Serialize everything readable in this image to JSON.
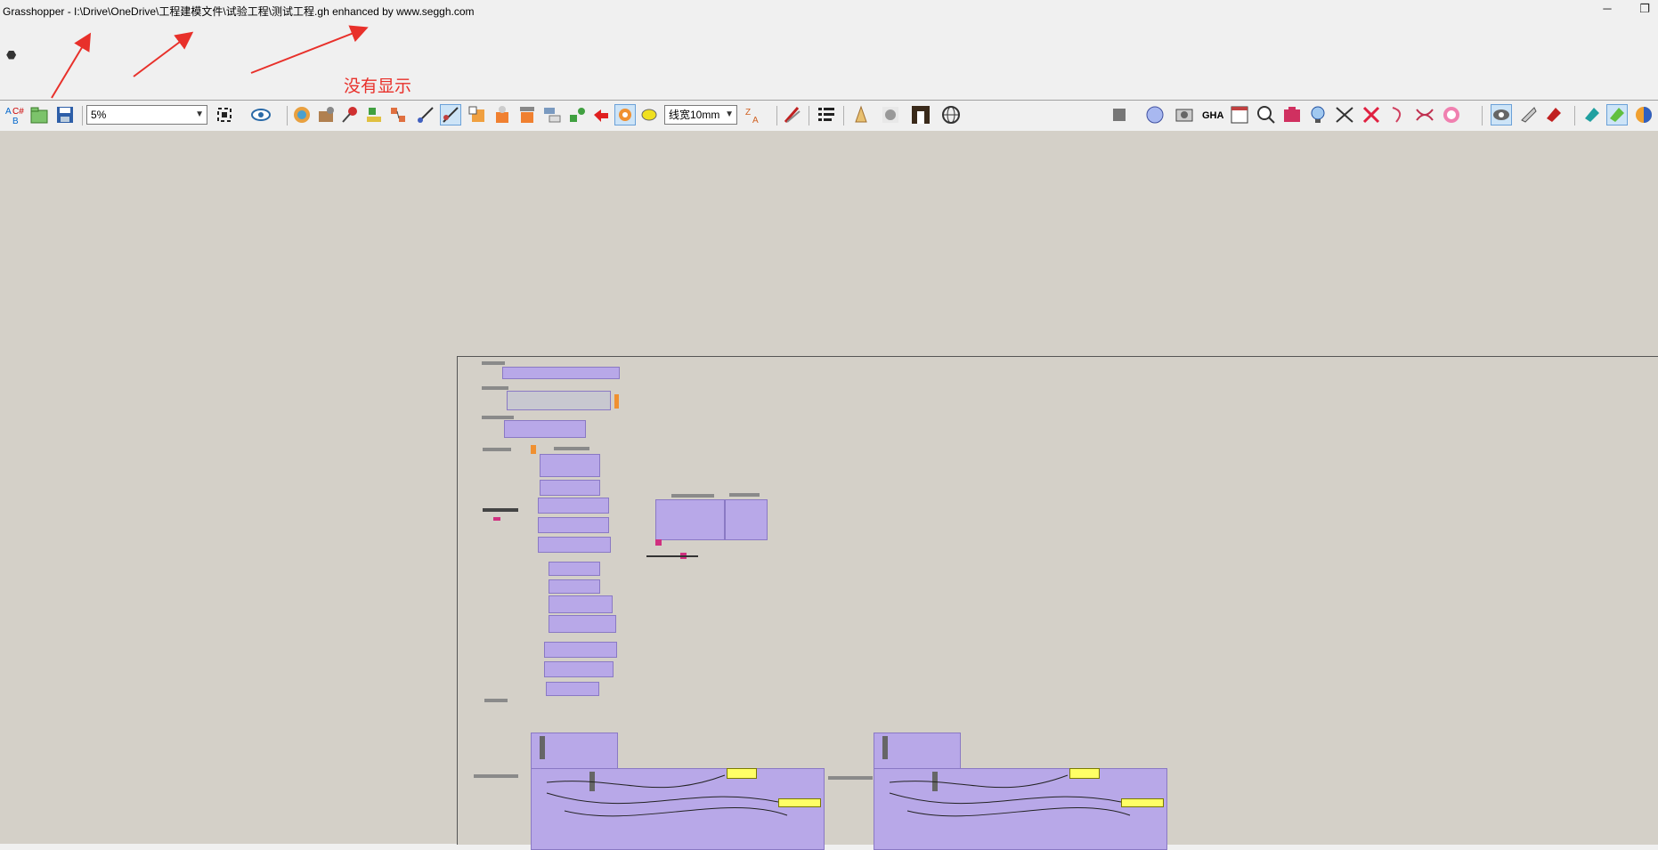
{
  "window": {
    "title": "Grasshopper - I:\\Drive\\OneDrive\\工程建模文件\\试验工程\\测试工程.gh  enhanced by www.seggh.com",
    "minimize_glyph": "─",
    "restore_glyph": "❐"
  },
  "annotation": {
    "text": "没有显示",
    "color": "#e8302a"
  },
  "toolbar": {
    "zoom_value": "5%",
    "line_width_value": "线宽10mm",
    "icons": [
      "csharp-script-icon",
      "open-file-icon",
      "save-file-icon",
      "zoom-extents-icon",
      "preview-eye-icon",
      "cat-component-icon",
      "cat-tool-icon",
      "pin-icon",
      "bake-icon",
      "cluster-icon",
      "wire-tool-icon",
      "selected-tool-icon",
      "group-icon",
      "param-icon",
      "cloud-icon",
      "network-icon",
      "refresh-icon",
      "settings-gear-icon",
      "yellow-marker-icon",
      "sort-icon",
      "brush-icon",
      "list-icon",
      "tree-icon",
      "cat-face-icon",
      "black-box-icon",
      "globe-icon",
      "stop-icon",
      "sphere-icon",
      "camera-icon",
      "gha-icon",
      "window-icon",
      "search-s-icon",
      "package-icon",
      "bulb-icon",
      "scissors-icon",
      "red-arrow-icon",
      "hook-icon",
      "swap-icon",
      "target-icon",
      "eye-preview-icon",
      "shaded-icon",
      "red-shape-icon",
      "teal-icon",
      "green-icon",
      "color-ball-icon"
    ]
  },
  "colors": {
    "canvas": "#d4d0c8",
    "group": "#b8a8e8",
    "panel_yellow": "#ffff66"
  }
}
